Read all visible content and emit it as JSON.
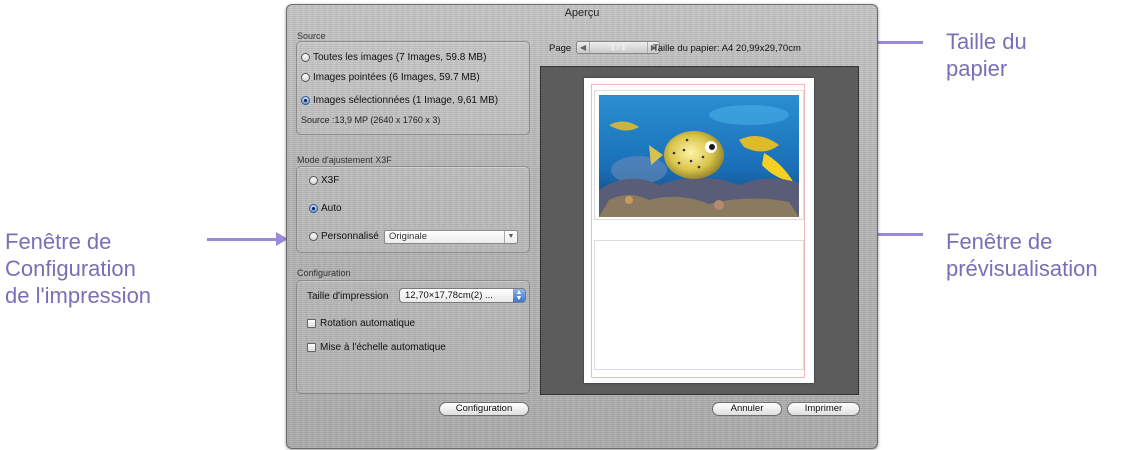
{
  "window": {
    "title": "Aperçu"
  },
  "source": {
    "group_label": "Source",
    "options": [
      {
        "label": "Toutes les images  (7 Images, 59.8 MB)",
        "selected": false
      },
      {
        "label": "Images pointées  (6 Images, 59.7 MB)",
        "selected": false
      },
      {
        "label": "Images sélectionnées  (1 Image, 9,61 MB)",
        "selected": true
      }
    ],
    "info": "Source :13,9 MP (2640 x 1760 x 3)"
  },
  "x3f_mode": {
    "group_label": "Mode d'ajustement X3F",
    "options": [
      {
        "label": "X3F",
        "selected": false
      },
      {
        "label": "Auto",
        "selected": true
      },
      {
        "label": "Personnalisé",
        "selected": false
      }
    ],
    "custom_select_value": "Originale"
  },
  "configuration": {
    "group_label": "Configuration",
    "print_size_label": "Taille d'impression",
    "print_size_value": "12,70×17,78cm(2) ...",
    "auto_rotate_label": "Rotation automatique",
    "auto_scale_label": "Mise à l'échelle automatique",
    "config_button": "Configuration"
  },
  "page_nav": {
    "label": "Page",
    "value": "1 / 1",
    "paper_size_label": "Taille du papier:  A4  20,99x29,70cm"
  },
  "buttons": {
    "cancel": "Annuler",
    "print": "Imprimer"
  },
  "annotations": {
    "paper_size": "Taille du\npapier",
    "print_config": "Fenêtre de\nConfiguration\nde l'impression",
    "preview": "Fenêtre de\nprévisualisation"
  },
  "colors": {
    "annotation_text": "#7a6fb6",
    "annotation_arrow": "#9b8ad6",
    "preview_bg": "#5c5c5c"
  }
}
